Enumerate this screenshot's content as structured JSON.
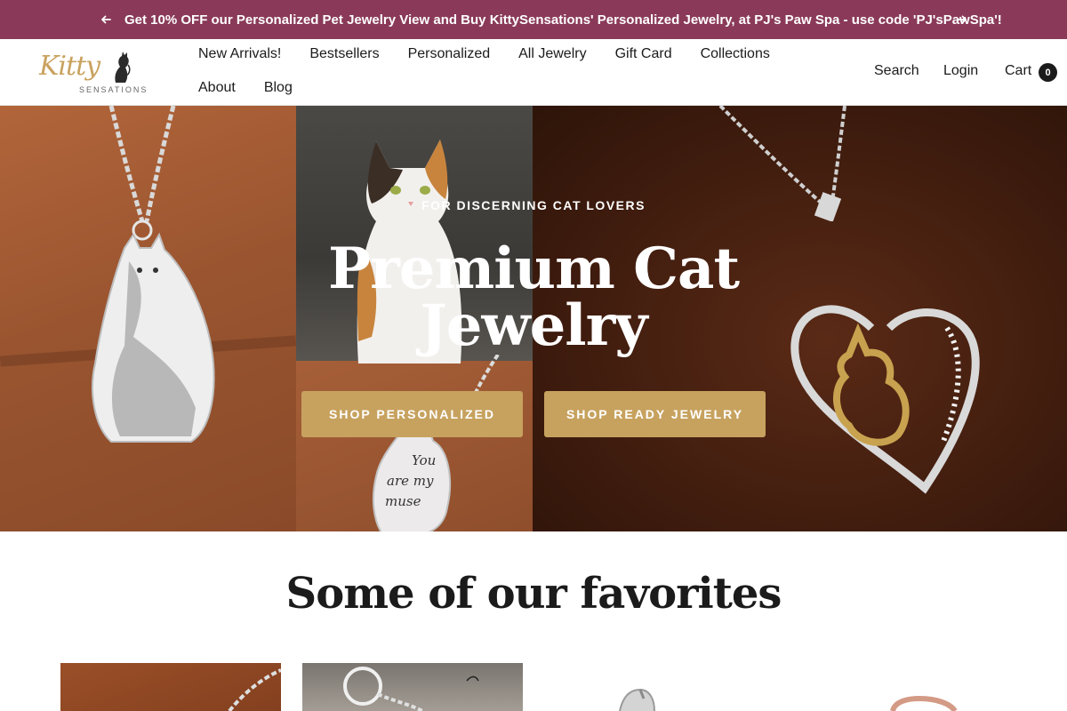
{
  "announcement": {
    "text": "Get 10% OFF our Personalized Pet Jewelry View and Buy KittySensations' Personalized Jewelry, at PJ's Paw Spa - use code 'PJ'sPawSpa'!",
    "prev_icon": "arrow-left-icon",
    "next_icon": "arrow-right-icon",
    "background": "#8a3a58"
  },
  "header": {
    "logo": {
      "script": "Kitty",
      "sub": "SENSATIONS"
    },
    "nav": [
      {
        "label": "New Arrivals!"
      },
      {
        "label": "Bestsellers"
      },
      {
        "label": "Personalized"
      },
      {
        "label": "All Jewelry"
      },
      {
        "label": "Gift Card"
      },
      {
        "label": "Collections"
      },
      {
        "label": "About"
      },
      {
        "label": "Blog"
      }
    ],
    "search_label": "Search",
    "login_label": "Login",
    "cart_label": "Cart",
    "cart_count": "0"
  },
  "hero": {
    "eyebrow": "FOR DISCERNING CAT LOVERS",
    "title_line1": "Premium Cat",
    "title_line2": "Jewelry",
    "button_personalized": "SHOP PERSONALIZED",
    "button_ready": "SHOP READY JEWELRY",
    "tag_text": [
      "You",
      "are my",
      "muse"
    ],
    "button_color": "#c7a25f"
  },
  "favorites": {
    "title": "Some of our favorites"
  }
}
